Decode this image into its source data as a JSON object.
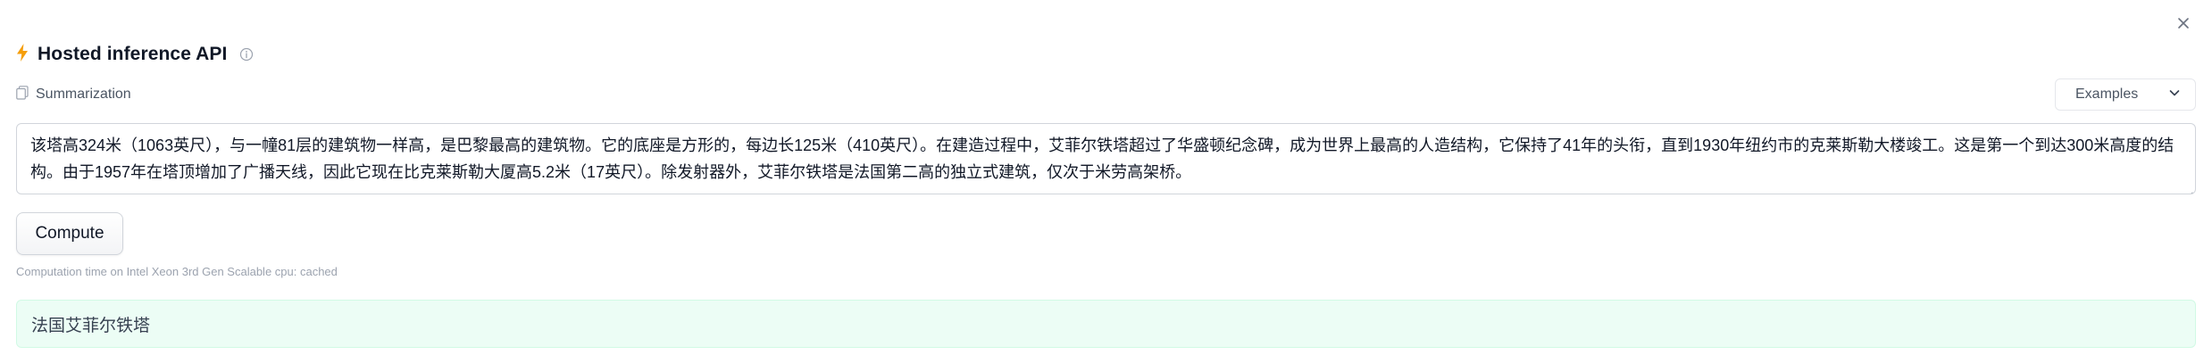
{
  "header": {
    "title": "Hosted inference API",
    "icon": "lightning-icon",
    "info_icon": "info-icon",
    "accent_color": "#f59e0b"
  },
  "window": {
    "close_icon": "close-icon"
  },
  "task": {
    "label": "Summarization",
    "icon": "document-icon"
  },
  "examples": {
    "label": "Examples",
    "icon": "chevron-down-icon"
  },
  "input": {
    "value": "该塔高324米（1063英尺），与一幢81层的建筑物一样高，是巴黎最高的建筑物。它的底座是方形的，每边长125米（410英尺）。在建造过程中，艾菲尔铁塔超过了华盛顿纪念碑，成为世界上最高的人造结构，它保持了41年的头衔，直到1930年纽约市的克莱斯勒大楼竣工。这是第一个到达300米高度的结构。由于1957年在塔顶增加了广播天线，因此它现在比克莱斯勒大厦高5.2米（17英尺）。除发射器外，艾菲尔铁塔是法国第二高的独立式建筑，仅次于米劳高架桥。"
  },
  "compute": {
    "label": "Compute"
  },
  "status": {
    "computation_time": "Computation time on Intel Xeon 3rd Gen Scalable cpu: cached"
  },
  "output": {
    "summary": "法国艾菲尔铁塔",
    "background_color": "#ecfdf5"
  }
}
